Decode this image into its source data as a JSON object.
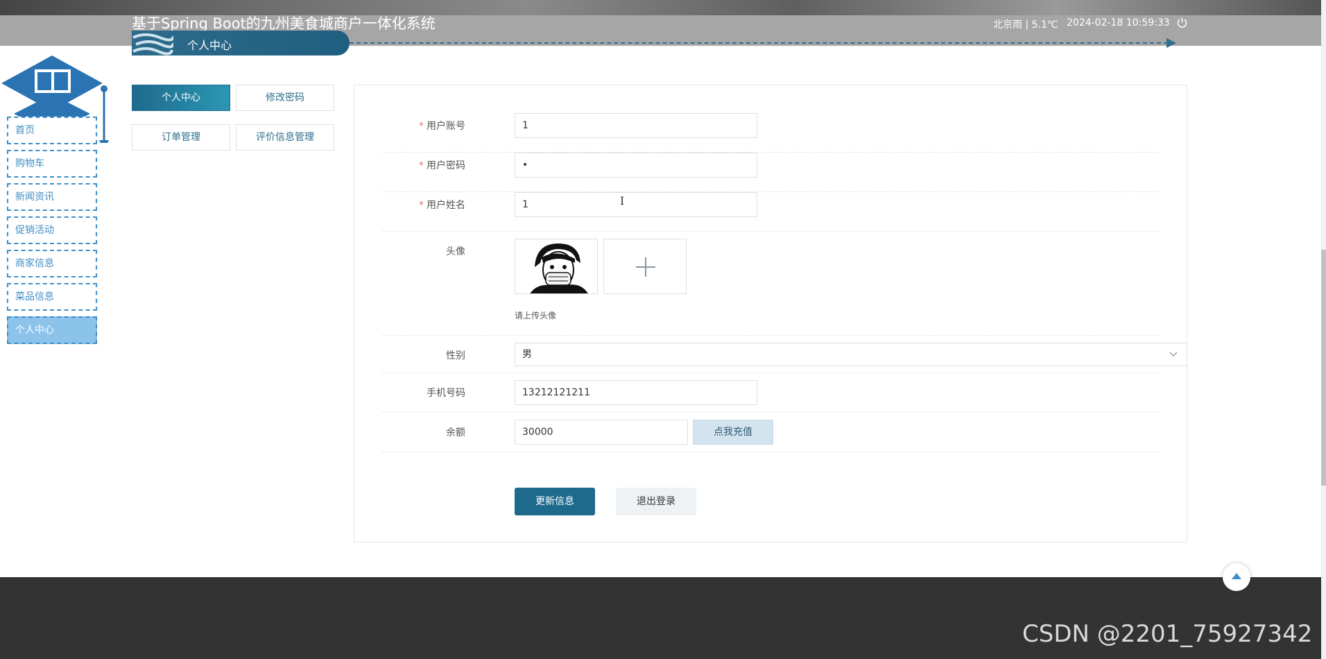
{
  "header": {
    "site_title": "基于Spring Boot的九州美食城商户一体化系统",
    "breadcrumb": "个人中心",
    "weather": "北京雨 | 5.1℃",
    "datetime": "2024-02-18  10:59:33"
  },
  "sidebar": {
    "items": [
      {
        "label": "首页"
      },
      {
        "label": "购物车"
      },
      {
        "label": "新闻资讯"
      },
      {
        "label": "促销活动"
      },
      {
        "label": "商家信息"
      },
      {
        "label": "菜品信息"
      },
      {
        "label": "个人中心"
      }
    ]
  },
  "tabs": {
    "profile": "个人中心",
    "change_password": "修改密码",
    "orders": "订单管理",
    "reviews": "评价信息管理"
  },
  "form": {
    "account_label": "用户账号",
    "account_value": "1",
    "password_label": "用户密码",
    "password_value": "•",
    "name_label": "用户姓名",
    "name_value": "1",
    "avatar_label": "头像",
    "avatar_hint": "请上传头像",
    "gender_label": "性别",
    "gender_value": "男",
    "phone_label": "手机号码",
    "phone_value": "13212121211",
    "balance_label": "余额",
    "balance_value": "30000",
    "recharge_button": "点我充值",
    "update_button": "更新信息",
    "logout_button": "退出登录"
  },
  "watermark": "CSDN @2201_75927342",
  "colors": {
    "primary": "#1e6a8d",
    "nav_border": "#3d8ec6",
    "nav_active": "#8cc3ea",
    "footer": "#333333"
  }
}
